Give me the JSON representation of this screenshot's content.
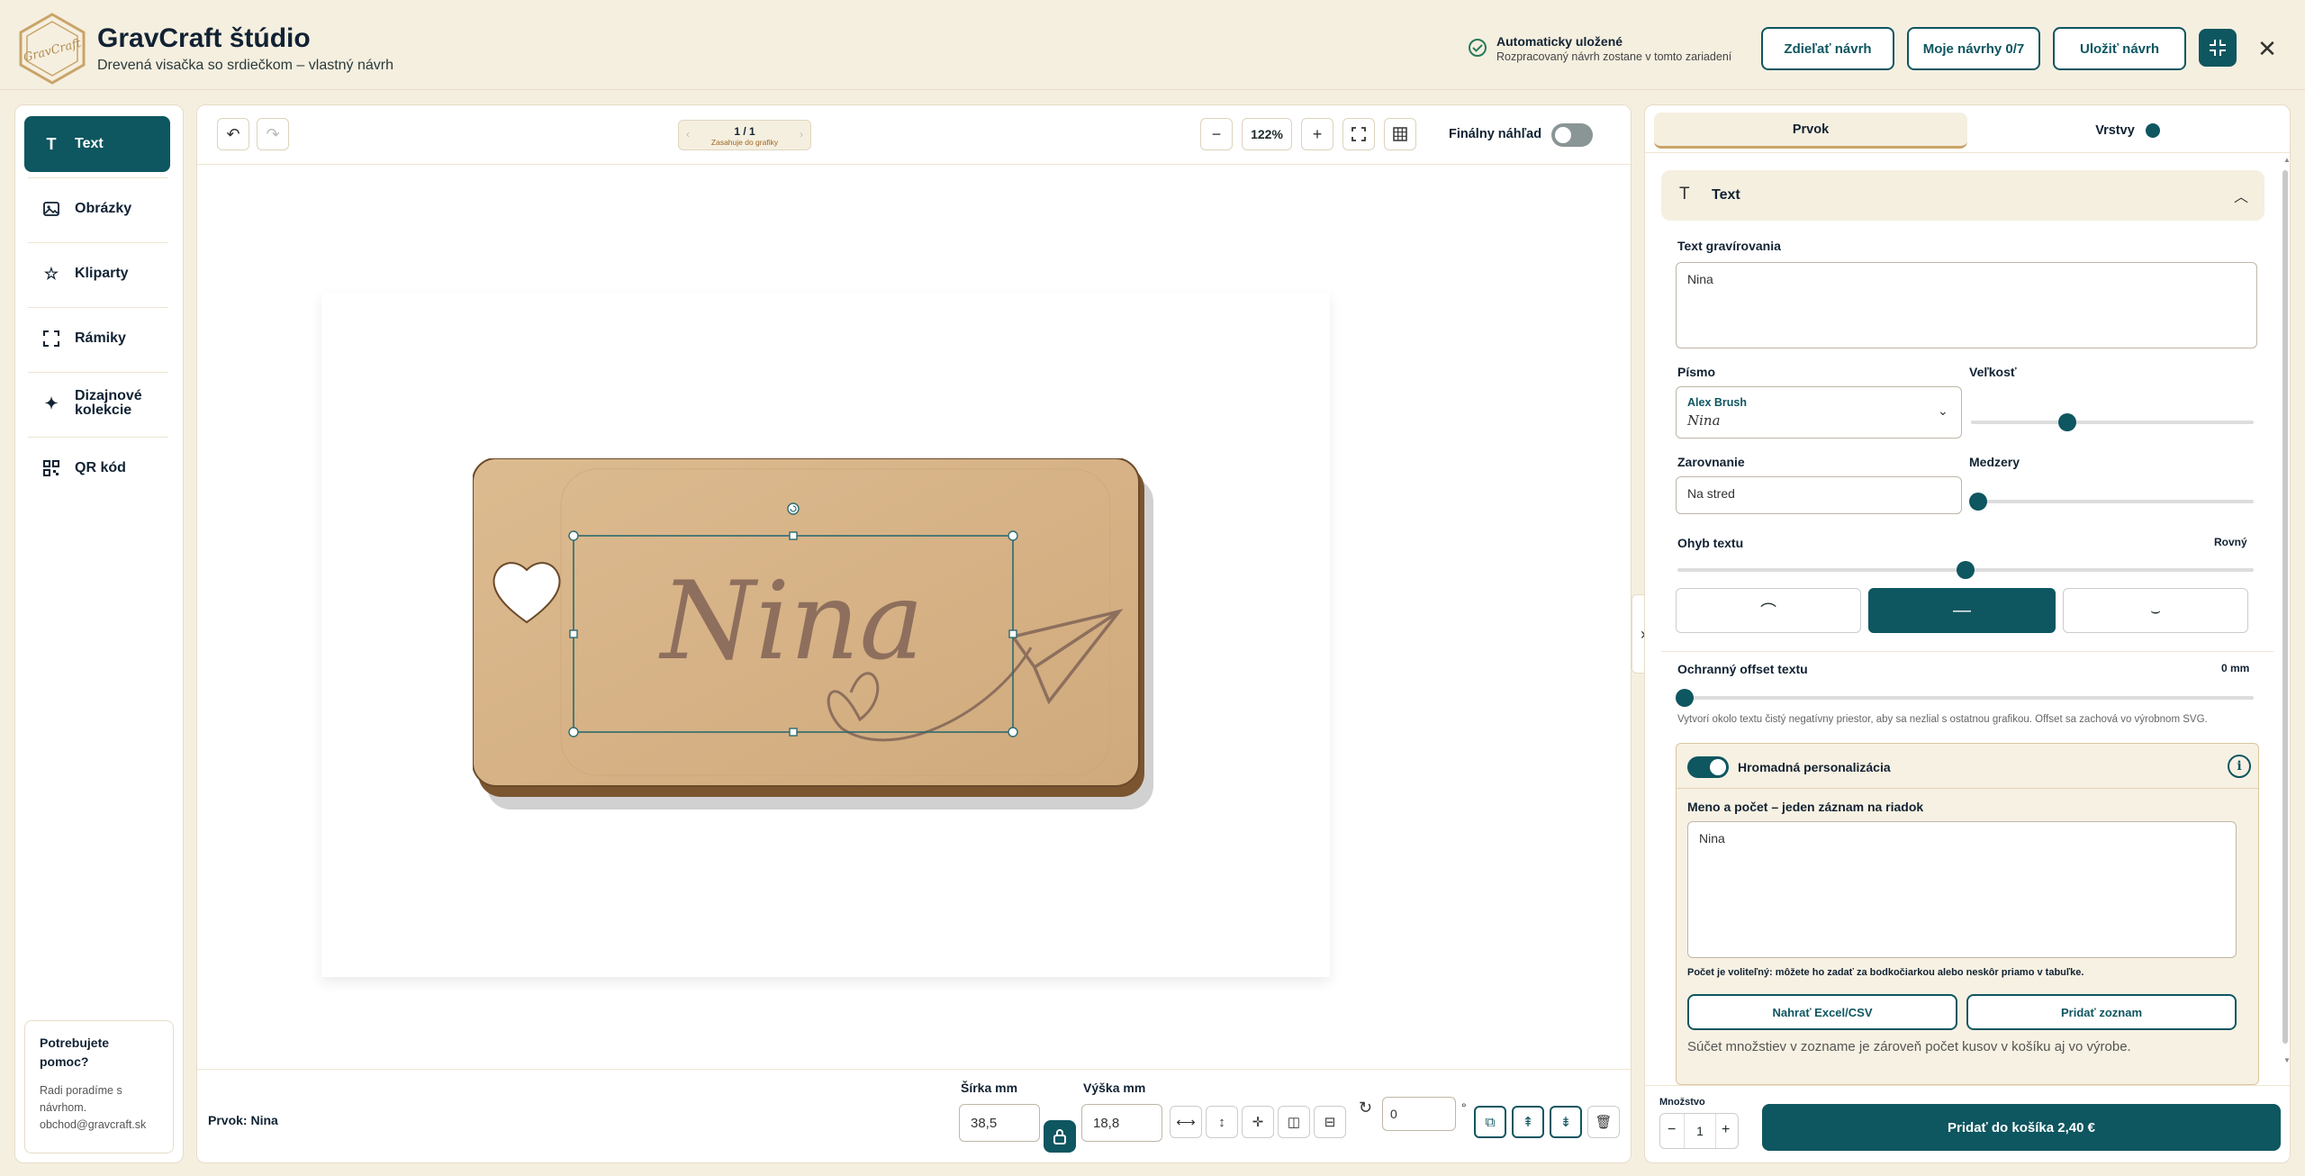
{
  "header": {
    "brand": "GravCraft štúdio",
    "logo_text": "GravCraft",
    "subtitle": "Drevená visačka so srdiečkom – vlastný návrh",
    "autosave_title": "Automaticky uložené",
    "autosave_sub": "Rozpracovaný návrh zostane v tomto zariadení",
    "share_label": "Zdieľať návrh",
    "my_designs_label": "Moje návrhy 0/7",
    "save_label": "Uložiť návrh"
  },
  "sidebar": {
    "items": [
      {
        "label": "Text",
        "icon": "text-icon"
      },
      {
        "label": "Obrázky",
        "icon": "image-icon"
      },
      {
        "label": "Kliparty",
        "icon": "star-icon"
      },
      {
        "label": "Rámiky",
        "icon": "frame-icon"
      },
      {
        "label": "Dizajnové kolekcie",
        "icon": "sparkle-icon"
      },
      {
        "label": "QR kód",
        "icon": "qr-icon"
      }
    ],
    "help_title": "Potrebujete pomoc?",
    "help_text": "Radi poradíme s návrhom.",
    "help_email": "obchod@gravcraft.sk"
  },
  "canvas": {
    "page_indicator": "1 / 1",
    "page_sub": "Zasahuje do grafiky",
    "zoom": "122%",
    "final_preview_label": "Finálny náhľad",
    "final_preview_on": false,
    "engraved_text": "Nina"
  },
  "bottombar": {
    "element_label": "Prvok: Nina",
    "width_label": "Šírka mm",
    "width_value": "38,5",
    "height_label": "Výška mm",
    "height_value": "18,8",
    "rotation_value": "0",
    "degree_symbol": "°"
  },
  "panel": {
    "tab_element": "Prvok",
    "tab_layers": "Vrstvy",
    "section_title": "Text",
    "engrave_label": "Text gravírovania",
    "engrave_value": "Nina",
    "font_label": "Písmo",
    "font_name": "Alex Brush",
    "font_sample": "Nina",
    "size_label": "Veľkosť",
    "size_fraction": 0.34,
    "align_label": "Zarovnanie",
    "align_value": "Na stred",
    "spacing_label": "Medzery",
    "spacing_fraction": 0.0,
    "curve_label": "Ohyb textu",
    "curve_value": "Rovný",
    "curve_fraction": 0.5,
    "offset_label": "Ochranný offset textu",
    "offset_value": "0 mm",
    "offset_fraction": 0.0,
    "offset_help": "Vytvorí okolo textu čistý negatívny priestor, aby sa nezlial s ostatnou grafikou. Offset sa zachová vo výrobnom SVG.",
    "bulk_label": "Hromadná personalizácia",
    "bulk_on": true,
    "bulk_list_label": "Meno a počet – jeden záznam na riadok",
    "bulk_list_value": "Nina",
    "bulk_hint": "Počet je voliteľný: môžete ho zadať za bodkočiarkou alebo neskôr priamo v tabuľke.",
    "upload_label": "Nahrať Excel/CSV",
    "add_list_label": "Pridať zoznam",
    "sum_note": "Súčet množstiev v zozname je zároveň počet kusov v košíku aj vo výrobe.",
    "qty_label": "Množstvo",
    "qty_value": "1",
    "add_to_cart_label": "Pridať do košíka 2,40 €"
  },
  "colors": {
    "accent": "#0e5660",
    "background": "#f5efe0",
    "wood": "#d6b489"
  }
}
